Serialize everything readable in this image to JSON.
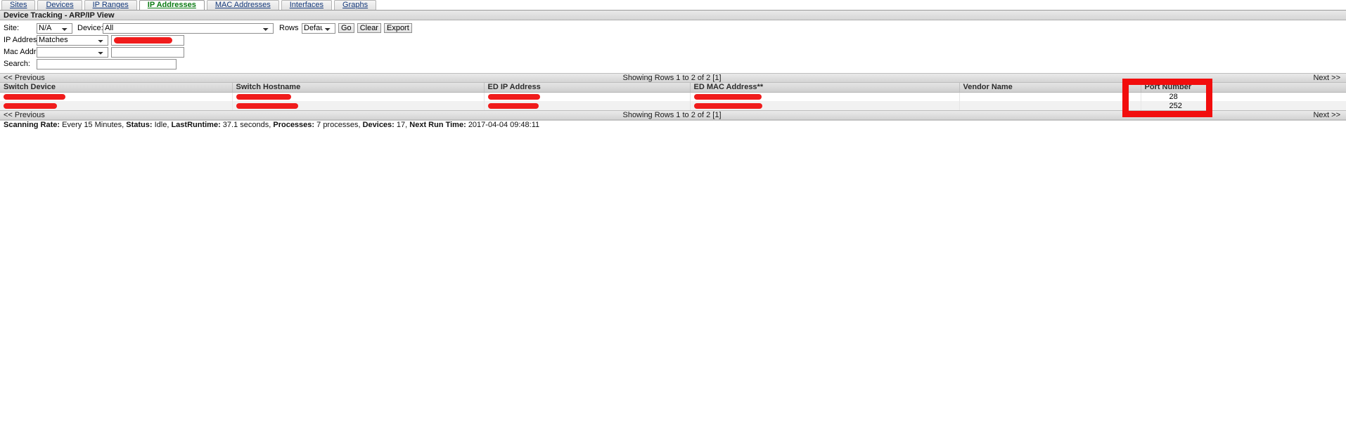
{
  "tabs": [
    {
      "label": "Sites",
      "active": false
    },
    {
      "label": "Devices",
      "active": false
    },
    {
      "label": "IP Ranges",
      "active": false
    },
    {
      "label": "IP Addresses",
      "active": true
    },
    {
      "label": "MAC Addresses",
      "active": false
    },
    {
      "label": "Interfaces",
      "active": false
    },
    {
      "label": "Graphs",
      "active": false
    }
  ],
  "section": {
    "title": "Device Tracking - ARP/IP View"
  },
  "filters": {
    "site_label": "Site:",
    "site_value": "N/A",
    "site_options": [
      "N/A"
    ],
    "device_label": "Device:",
    "device_value": "All",
    "device_options": [
      "All"
    ],
    "rows_label": "Rows",
    "rows_value": "Default",
    "rows_options": [
      "Default"
    ],
    "go_label": "Go",
    "clear_label": "Clear",
    "export_label": "Export",
    "ip_label": "IP Address:",
    "ip_condition": "Matches",
    "ip_condition_options": [
      "Matches"
    ],
    "ip_value": "",
    "mac_label": "Mac Address:",
    "mac_condition": "",
    "mac_condition_options": [
      ""
    ],
    "mac_value": "",
    "search_label": "Search:",
    "search_value": ""
  },
  "pager": {
    "previous_label": "<< Previous",
    "showing_label": "Showing Rows 1 to 2 of 2 [1]",
    "next_label": "Next >>"
  },
  "table": {
    "columns": [
      "Switch Device",
      "Switch Hostname",
      "ED IP Address",
      "ED MAC Address**",
      "Vendor Name",
      "Port Number"
    ],
    "rows": [
      {
        "switch_device": "",
        "switch_hostname": "",
        "ed_ip_address": "",
        "ed_mac_address": "",
        "vendor_name": "",
        "port_number": "28"
      },
      {
        "switch_device": "",
        "switch_hostname": "",
        "ed_ip_address": "",
        "ed_mac_address": "",
        "vendor_name": "",
        "port_number": "252"
      }
    ]
  },
  "status": {
    "scanning_rate_label": "Scanning Rate:",
    "scanning_rate_value": "Every 15 Minutes,",
    "status_label": "Status:",
    "status_value": "Idle,",
    "lastruntime_label": "LastRuntime:",
    "lastruntime_value": "37.1 seconds,",
    "processes_label": "Processes:",
    "processes_value": "7 processes,",
    "devices_label": "Devices:",
    "devices_value": "17,",
    "next_run_label": "Next Run Time:",
    "next_run_value": "2017-04-04 09:48:11"
  },
  "colors": {
    "redaction": "#f01c1c",
    "highlight": "#f20d0d",
    "active_tab": "#0a7a12",
    "link": "#13387a"
  }
}
